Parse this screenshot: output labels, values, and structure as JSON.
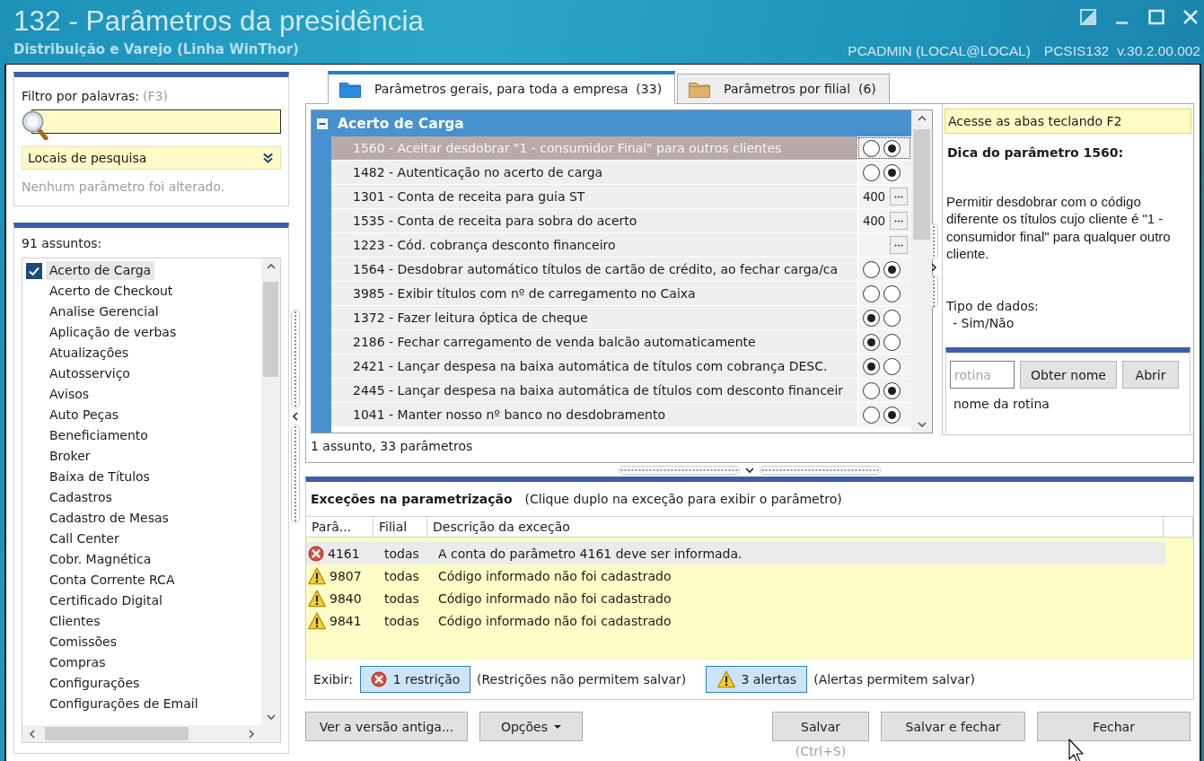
{
  "window": {
    "title": "132 - Parâmetros da presidência",
    "subtitle": "Distribuição e Varejo (Linha WinThor)",
    "user": "PCADMIN (LOCAL@LOCAL)",
    "program": "PCSIS132",
    "version": "v.30.2.00.002"
  },
  "filter": {
    "label": "Filtro por palavras:",
    "shortcut": "(F3)",
    "search_locations": "Locais de pesquisa",
    "status": "Nenhum parâmetro foi alterado."
  },
  "subjects": {
    "count_label": "91 assuntos:",
    "items": [
      {
        "label": "Acerto de Carga",
        "checked": true,
        "selected": true
      },
      {
        "label": "Acerto de Checkout",
        "checked": false,
        "selected": false
      },
      {
        "label": "Analise Gerencial",
        "checked": false,
        "selected": false
      },
      {
        "label": "Aplicação de verbas",
        "checked": false,
        "selected": false
      },
      {
        "label": "Atualizações",
        "checked": false,
        "selected": false
      },
      {
        "label": "Autosserviço",
        "checked": false,
        "selected": false
      },
      {
        "label": "Avisos",
        "checked": false,
        "selected": false
      },
      {
        "label": "Auto Peças",
        "checked": false,
        "selected": false
      },
      {
        "label": "Beneficiamento",
        "checked": false,
        "selected": false
      },
      {
        "label": "Broker",
        "checked": false,
        "selected": false
      },
      {
        "label": "Baixa de Títulos",
        "checked": false,
        "selected": false
      },
      {
        "label": "Cadastros",
        "checked": false,
        "selected": false
      },
      {
        "label": "Cadastro de Mesas",
        "checked": false,
        "selected": false
      },
      {
        "label": "Call Center",
        "checked": false,
        "selected": false
      },
      {
        "label": "Cobr. Magnética",
        "checked": false,
        "selected": false
      },
      {
        "label": "Conta Corrente RCA",
        "checked": false,
        "selected": false
      },
      {
        "label": "Certificado Digital",
        "checked": false,
        "selected": false
      },
      {
        "label": "Clientes",
        "checked": false,
        "selected": false
      },
      {
        "label": "Comissões",
        "checked": false,
        "selected": false
      },
      {
        "label": "Compras",
        "checked": false,
        "selected": false
      },
      {
        "label": "Configurações",
        "checked": false,
        "selected": false
      },
      {
        "label": "Configurações de Email",
        "checked": false,
        "selected": false
      }
    ]
  },
  "tabs": [
    {
      "label": "Parâmetros gerais, para toda a empresa  (33)",
      "kind": "company",
      "selected": true
    },
    {
      "label": "Parâmetros por filial  (6)",
      "kind": "branch",
      "selected": false
    }
  ],
  "parameters": {
    "group": "Acerto de Carga",
    "expanded": true,
    "rows": [
      {
        "text": "1560 - Aceitar desdobrar \"1 - consumidor Final\" para outros clientes",
        "kind": "yesno",
        "selected": true,
        "options": [
          {
            "selected": false
          },
          {
            "selected": true
          }
        ]
      },
      {
        "text": "1482 - Autenticação no acerto de carga",
        "kind": "yesno",
        "selected": false,
        "options": [
          {
            "selected": false
          },
          {
            "selected": true
          }
        ]
      },
      {
        "text": "1301 - Conta de receita para guia ST",
        "kind": "code",
        "selected": false,
        "value": "400"
      },
      {
        "text": "1535 - Conta de receita para sobra do acerto",
        "kind": "code",
        "selected": false,
        "value": "400"
      },
      {
        "text": "1223 - Cód. cobrança desconto financeiro",
        "kind": "code",
        "selected": false
      },
      {
        "text": "1564 - Desdobrar automático títulos de cartão de crédito, ao fechar carga/ca",
        "kind": "yesno",
        "selected": false,
        "options": [
          {
            "selected": false
          },
          {
            "selected": true
          }
        ]
      },
      {
        "text": "3985 - Exibir títulos com nº de carregamento no Caixa",
        "kind": "yesno",
        "selected": false,
        "options": [
          {
            "selected": false
          },
          {
            "selected": false
          }
        ]
      },
      {
        "text": "1372 - Fazer leitura óptica de cheque",
        "kind": "yesno",
        "selected": false,
        "options": [
          {
            "selected": true
          },
          {
            "selected": false
          }
        ]
      },
      {
        "text": "2186 - Fechar carregamento de venda balcão automaticamente",
        "kind": "yesno",
        "selected": false,
        "options": [
          {
            "selected": true
          },
          {
            "selected": false
          }
        ]
      },
      {
        "text": "2421 - Lançar despesa na baixa automática de títulos com cobrança DESC.",
        "kind": "yesno",
        "selected": false,
        "options": [
          {
            "selected": true
          },
          {
            "selected": false
          }
        ]
      },
      {
        "text": "2445 - Lançar despesa na baixa automática de títulos com desconto financeir",
        "kind": "yesno",
        "selected": false,
        "options": [
          {
            "selected": false
          },
          {
            "selected": true
          }
        ]
      },
      {
        "text": "1041 - Manter nosso nº banco no desdobramento",
        "kind": "yesno",
        "selected": false,
        "options": [
          {
            "selected": false
          },
          {
            "selected": true
          }
        ]
      }
    ],
    "status": "1 assunto, 33 parâmetros"
  },
  "tip": {
    "hint": "Acesse as abas teclando F2",
    "title": "Dica do parâmetro 1560:",
    "description": "Permitir desdobrar com o código diferente os títulos cujo cliente é \"1 - consumidor final\" para qualquer outro cliente.",
    "data_type_label": "Tipo de dados:",
    "data_type": "- Sim/Não"
  },
  "routine": {
    "placeholder": "rotina",
    "get_name_button": "Obter nome",
    "open_button": "Abrir",
    "name_label": "nome da rotina"
  },
  "exceptions": {
    "title": "Exceções na parametrização",
    "hint": "(Clique duplo na exceção para exibir o parâmetro)",
    "columns": [
      "Parâ...",
      "Filial",
      "Descrição da exceção"
    ],
    "rows": [
      {
        "kind": "error",
        "param": "4161",
        "branch": "todas",
        "description": "A conta do parâmetro 4161 deve ser informada.",
        "selected": true
      },
      {
        "kind": "warning",
        "param": "9807",
        "branch": "todas",
        "description": "Código informado não foi cadastrado",
        "selected": false
      },
      {
        "kind": "warning",
        "param": "9840",
        "branch": "todas",
        "description": "Código informado não foi cadastrado",
        "selected": false
      },
      {
        "kind": "warning",
        "param": "9841",
        "branch": "todas",
        "description": "Código informado não foi cadastrado",
        "selected": false
      }
    ],
    "filter_label": "Exibir:",
    "filters": [
      {
        "kind": "error",
        "label": "1 restrição",
        "note": "(Restrições não permitem salvar)",
        "selected": true
      },
      {
        "kind": "warning",
        "label": "3 alertas",
        "note": "(Alertas permitem salvar)",
        "selected": true
      }
    ]
  },
  "footer": {
    "left_buttons": [
      {
        "label": "Ver a versão antiga...",
        "kind": "plain"
      },
      {
        "label": "Opções",
        "kind": "menu"
      }
    ],
    "right_buttons": [
      {
        "label": "Salvar",
        "shortcut": "(Ctrl+S)"
      },
      {
        "label": "Salvar e fechar"
      },
      {
        "label": "Fechar"
      }
    ]
  }
}
